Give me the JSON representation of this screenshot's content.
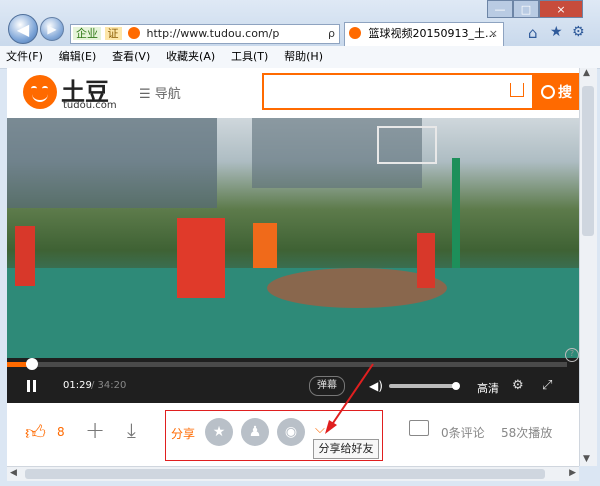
{
  "browser": {
    "address_prefix": "企业",
    "cert_label": "证",
    "address_url": "http://www.tudou.com/p",
    "search_symbol": "ρ",
    "tab_title": "篮球视频20150913_土...",
    "tab_close": "×",
    "nav_back": "◀",
    "nav_forward": "▶",
    "window_buttons": {
      "minimize": "—",
      "maximize": "□",
      "close": "×"
    },
    "tool_icons": {
      "home": "⌂",
      "favorites": "★",
      "settings": "⚙"
    }
  },
  "menu": [
    "文件(F)",
    "编辑(E)",
    "查看(V)",
    "收藏夹(A)",
    "工具(T)",
    "帮助(H)"
  ],
  "site": {
    "logo_text": "土豆",
    "logo_sub": "tudou.com",
    "nav_label": "☰ 导航",
    "search_button": "搜"
  },
  "player": {
    "current_time": "01:29",
    "total_time": "/ 34:20",
    "progress_fraction": 0.043,
    "danmu_label": "弹幕",
    "quality_label": "高清",
    "volume_fraction": 0.95
  },
  "actions": {
    "like_count": "8",
    "share_label": "分享",
    "tooltip": "分享给好友",
    "comments": "0条评论",
    "plays": "58次播放"
  },
  "colors": {
    "brand": "#ff6a00",
    "highlight": "#e01f1f"
  }
}
